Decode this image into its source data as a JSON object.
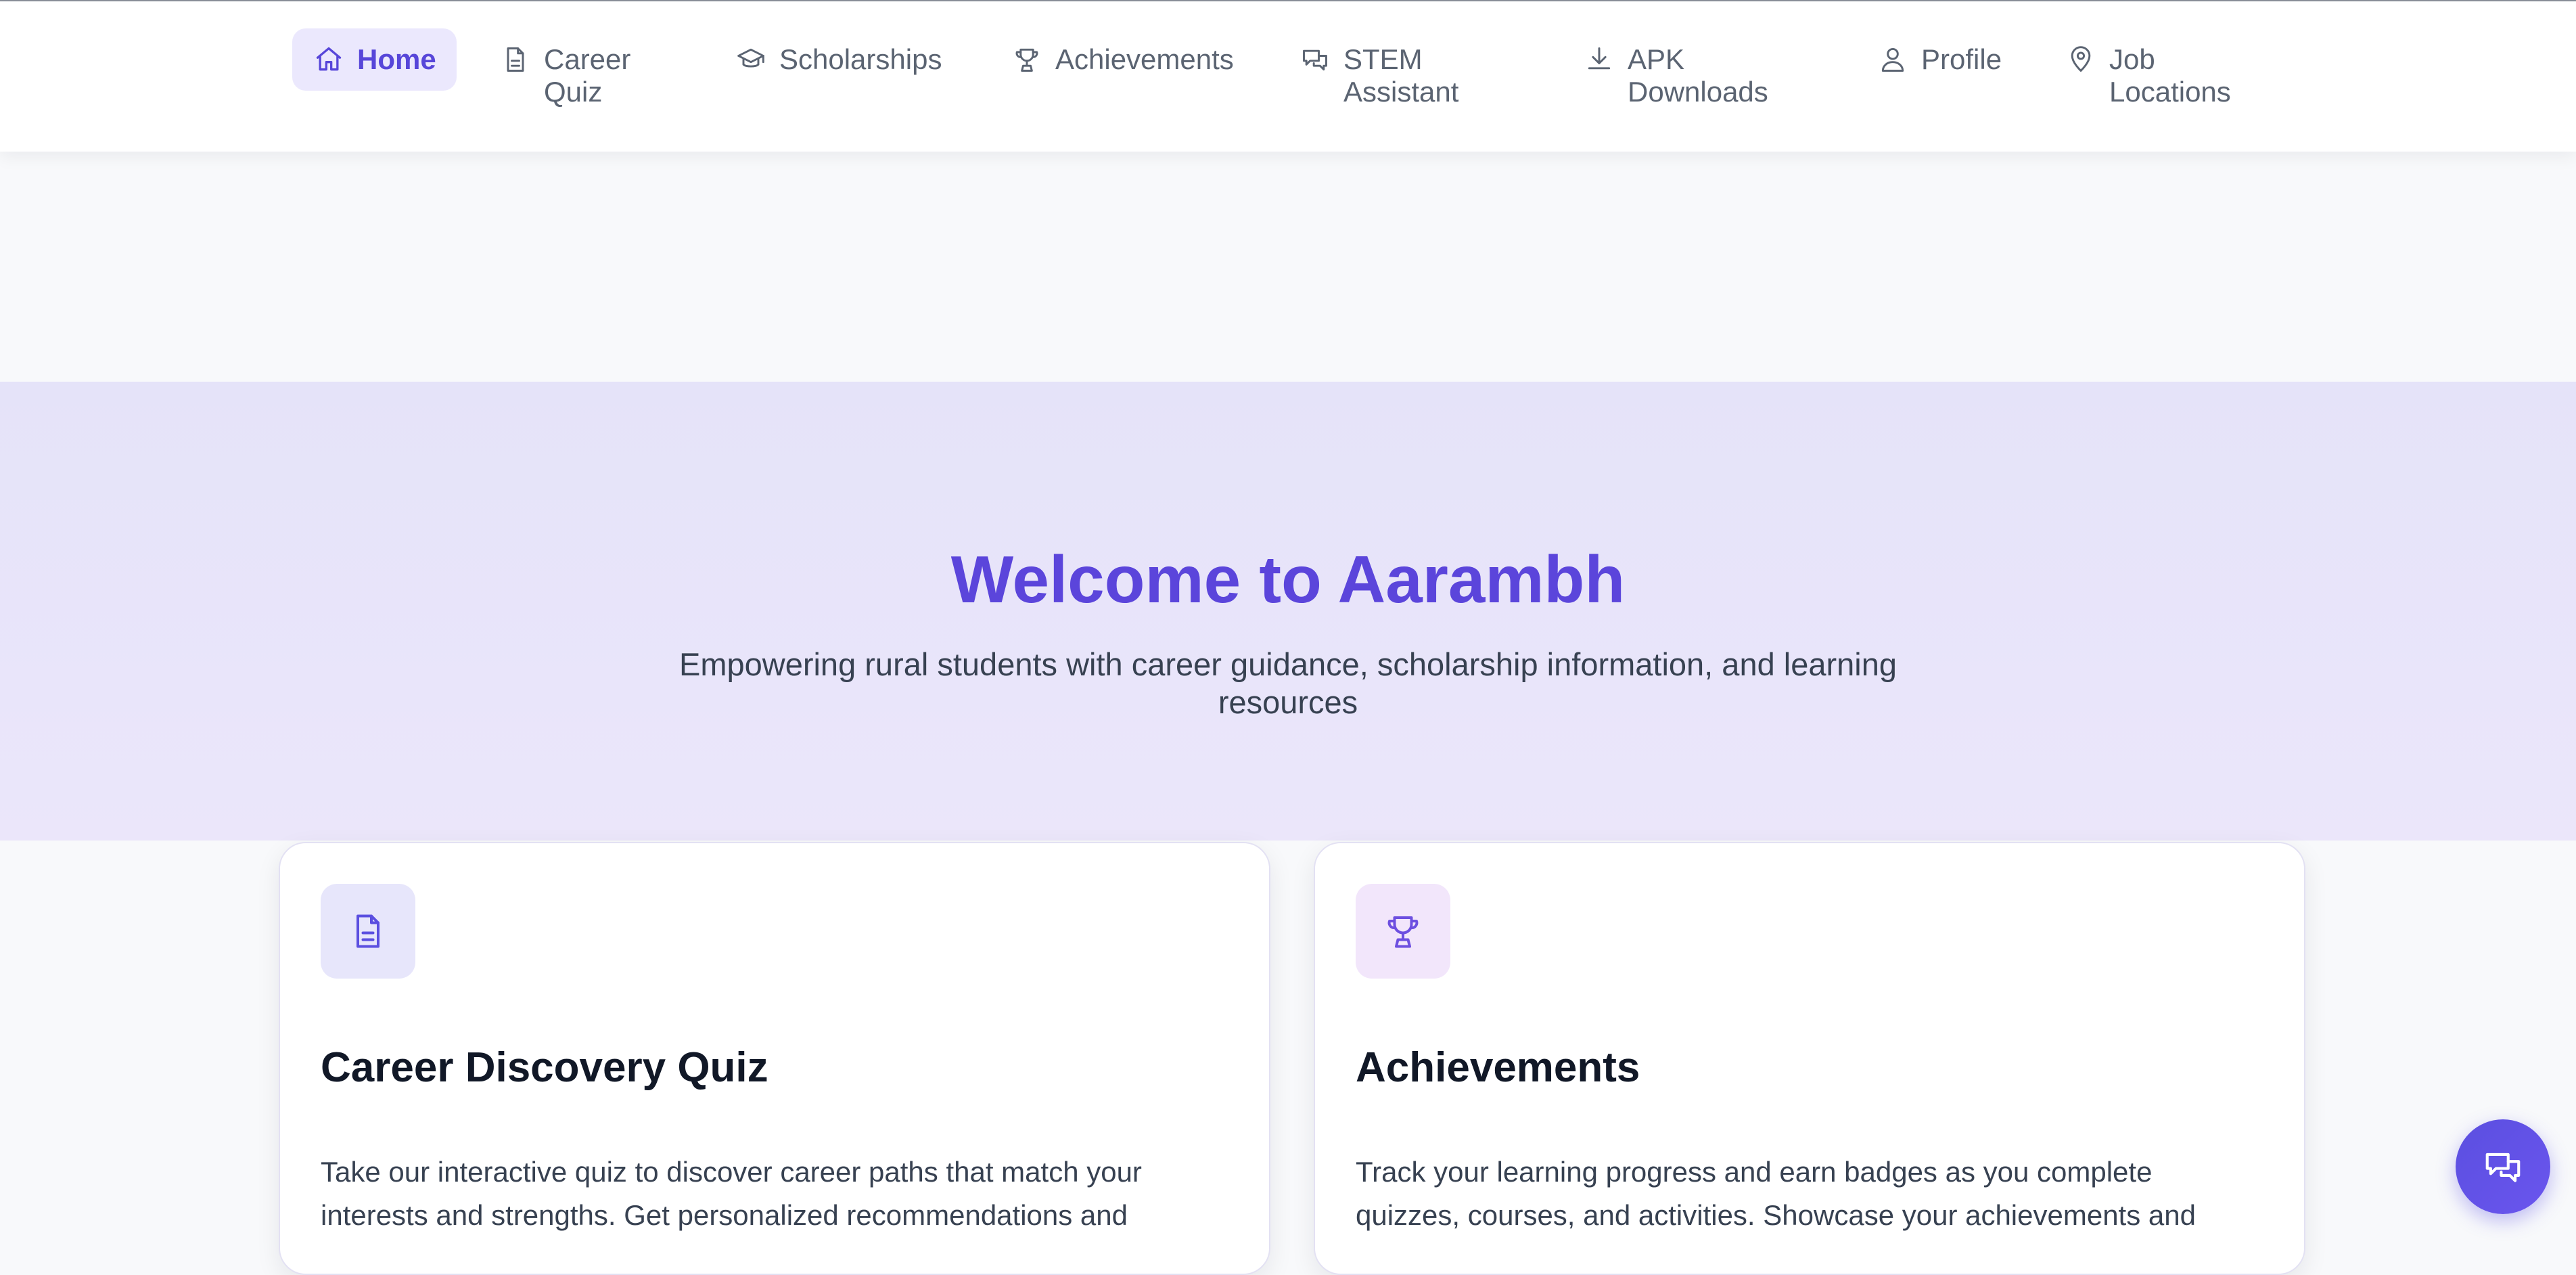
{
  "nav": {
    "items": [
      {
        "label": "Home",
        "icon": "home-icon",
        "active": true
      },
      {
        "label": "Career\nQuiz",
        "icon": "document-icon"
      },
      {
        "label": "Scholarships",
        "icon": "graduation-cap-icon"
      },
      {
        "label": "Achievements",
        "icon": "trophy-icon"
      },
      {
        "label": "STEM\nAssistant",
        "icon": "chat-icon"
      },
      {
        "label": "APK\nDownloads",
        "icon": "download-icon"
      },
      {
        "label": "Profile",
        "icon": "user-icon"
      },
      {
        "label": "Job\nLocations",
        "icon": "map-pin-icon"
      }
    ]
  },
  "hero": {
    "title": "Welcome to Aarambh",
    "subtitle": "Empowering rural students with career guidance, scholarship information, and learning resources"
  },
  "cards": [
    {
      "title": "Career Discovery Quiz",
      "description": "Take our interactive quiz to discover career paths that match your interests and strengths. Get personalized recommendations and",
      "icon": "document-icon",
      "icon_bg": "#e7e6fb",
      "icon_color": "#5b4fe0"
    },
    {
      "title": "Achievements",
      "description": "Track your learning progress and earn badges as you complete quizzes, courses, and activities. Showcase your achievements and",
      "icon": "trophy-icon",
      "icon_bg": "#f2e6fb",
      "icon_color": "#7c3aed"
    }
  ],
  "chat_button": {
    "icon": "chat-icon"
  },
  "colors": {
    "accent": "#5b45db",
    "active_bg": "#ebe8fd",
    "hero_bg": "#e7e4f9",
    "text_muted": "#5b6472"
  }
}
